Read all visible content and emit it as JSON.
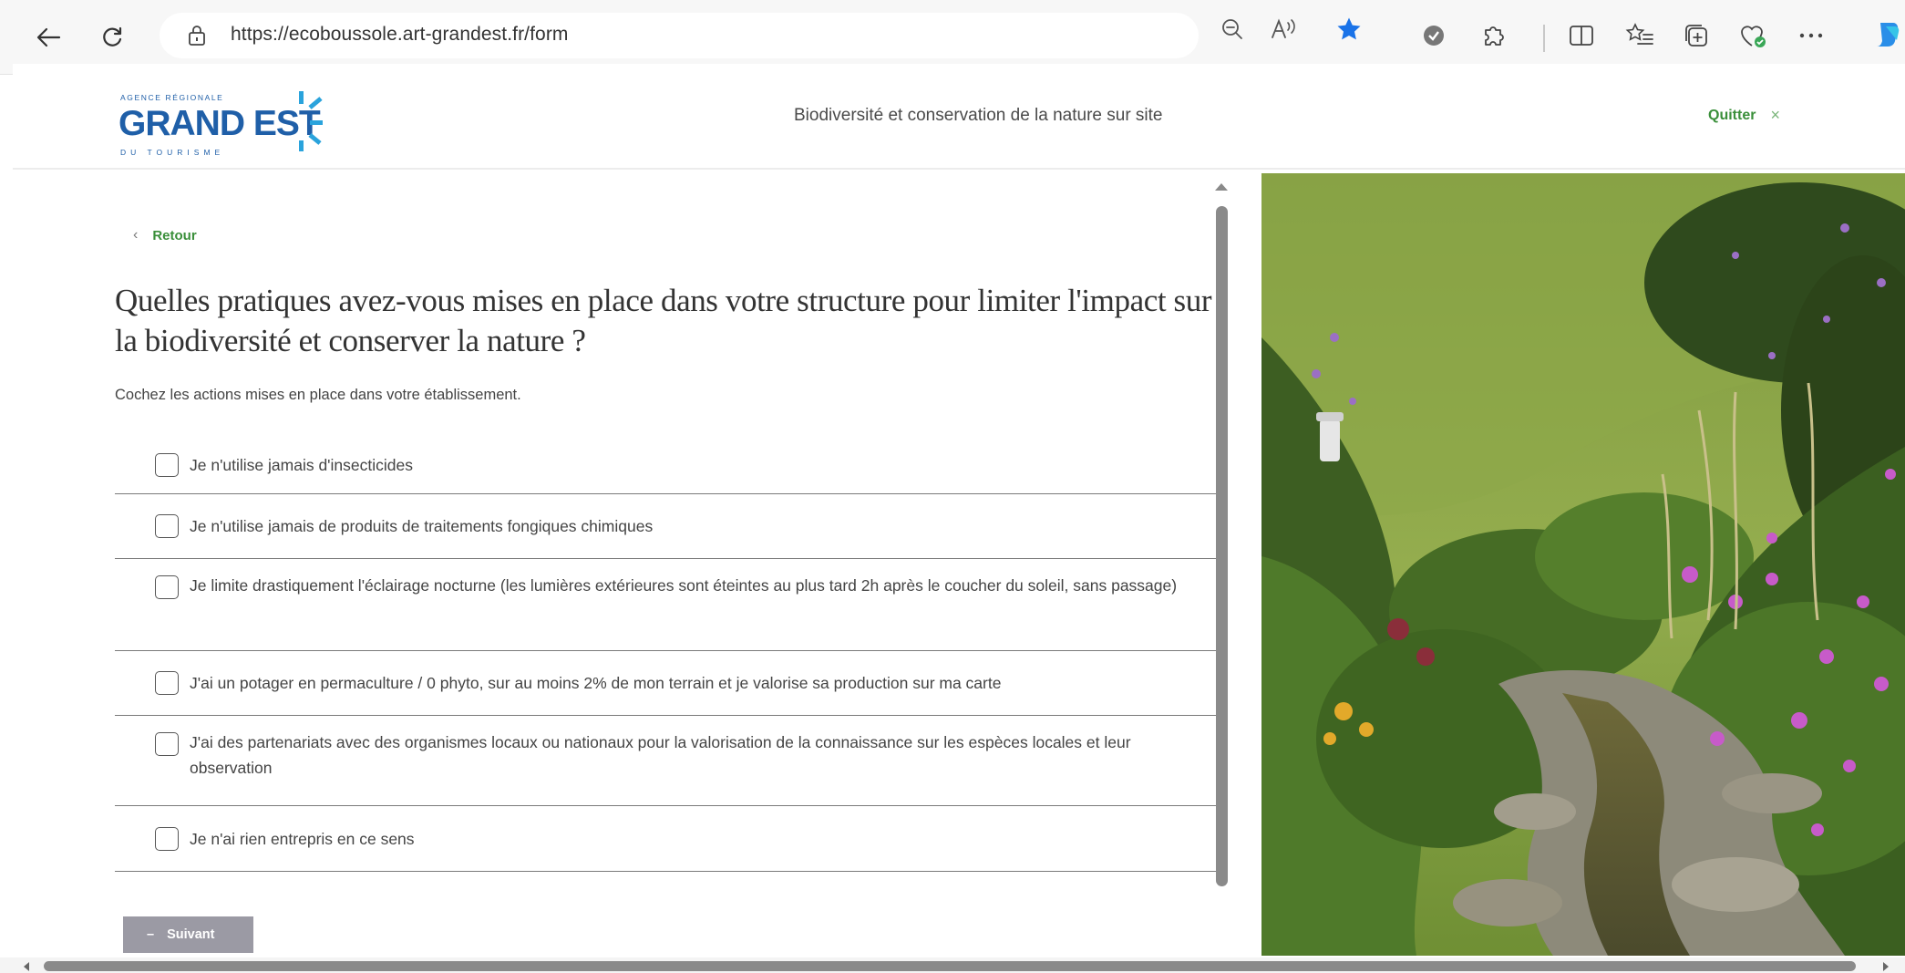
{
  "browser": {
    "url": "https://ecoboussole.art-grandest.fr/form",
    "icons": [
      "back-arrow-icon",
      "refresh-icon",
      "lock-icon",
      "zoom-out-icon",
      "read-aloud-icon",
      "favorite-star-icon",
      "extension-icon",
      "extensions-puzzle-icon",
      "split-screen-icon",
      "favorites-list-icon",
      "collections-icon",
      "browser-essentials-icon",
      "more-icon",
      "copilot-icon"
    ],
    "accent_color": "#1a73e8"
  },
  "header": {
    "logo": {
      "line1": "AGENCE RÉGIONALE",
      "line2": "GRAND EST",
      "line3": "DU TOURISME"
    },
    "title": "Biodiversité et conservation de la nature sur site",
    "quit_label": "Quitter",
    "quit_icon": "×"
  },
  "form": {
    "back_label": "Retour",
    "back_icon": "‹",
    "question": "Quelles pratiques avez-vous mises en place dans votre structure pour limiter l'impact sur la biodiversité et conserver la nature ?",
    "subtitle": "Cochez les actions mises en place dans votre établissement.",
    "options": [
      {
        "label": "Je n'utilise jamais d'insecticides",
        "checked": false
      },
      {
        "label": "Je n'utilise jamais de produits de traitements fongiques chimiques",
        "checked": false
      },
      {
        "label": "Je limite drastiquement l'éclairage nocturne (les lumières extérieures sont éteintes au plus tard 2h après le coucher du soleil, sans passage)",
        "checked": false
      },
      {
        "label": "J'ai un potager en permaculture / 0 phyto, sur au moins 2% de mon terrain et je valorise sa production sur ma carte",
        "checked": false
      },
      {
        "label": "J'ai des partenariats avec des organismes locaux ou nationaux pour la valorisation de la connaissance sur les espèces locales et leur observation",
        "checked": false
      },
      {
        "label": "Je n'ai rien entrepris en ce sens",
        "checked": false
      }
    ],
    "next_label": "Suivant",
    "next_icon": "–"
  },
  "colors": {
    "brand_blue": "#1f5fa8",
    "brand_green": "#3a8f3a",
    "disabled_button": "#9b9aa4"
  }
}
